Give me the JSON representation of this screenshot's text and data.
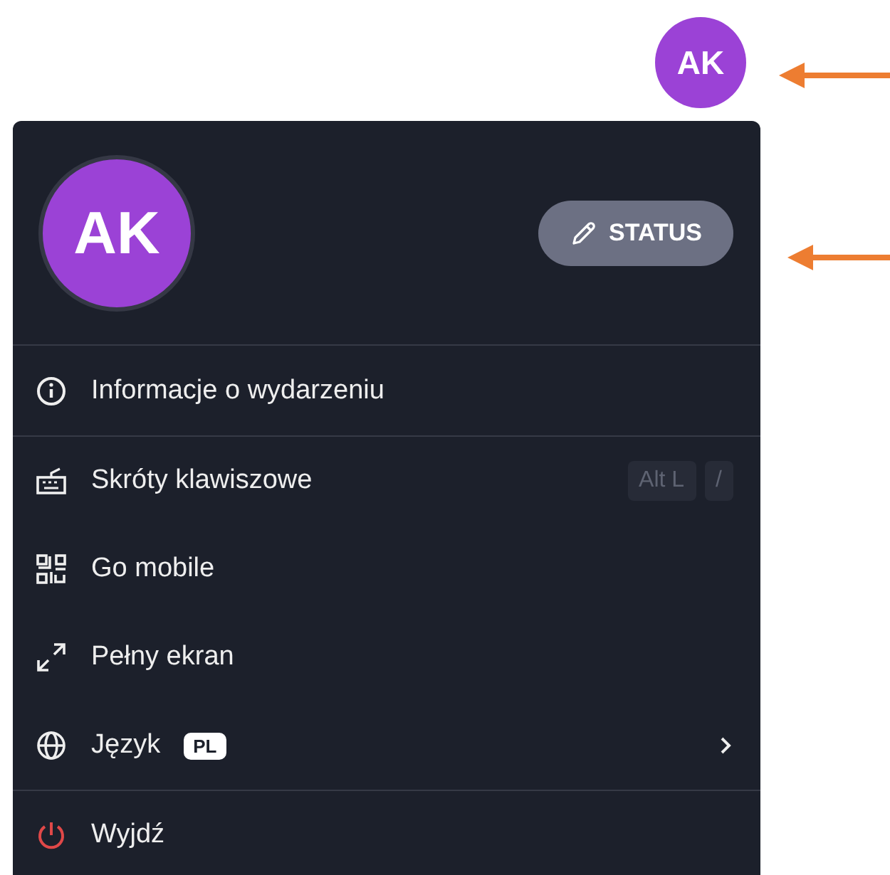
{
  "top_avatar": {
    "initials": "AK"
  },
  "profile": {
    "initials": "AK",
    "status_button": "STATUS"
  },
  "sections": [
    [
      {
        "kind": "info",
        "label": "Informacje o wydarzeniu"
      }
    ],
    [
      {
        "kind": "shortcuts",
        "label": "Skróty klawiszowe",
        "keys": [
          "Alt L",
          "/"
        ]
      },
      {
        "kind": "qr",
        "label": "Go mobile"
      },
      {
        "kind": "fullscreen",
        "label": "Pełny ekran"
      },
      {
        "kind": "language",
        "label": "Język",
        "badge": "PL",
        "has_submenu": true
      }
    ],
    [
      {
        "kind": "exit",
        "label": "Wyjdź"
      }
    ]
  ]
}
